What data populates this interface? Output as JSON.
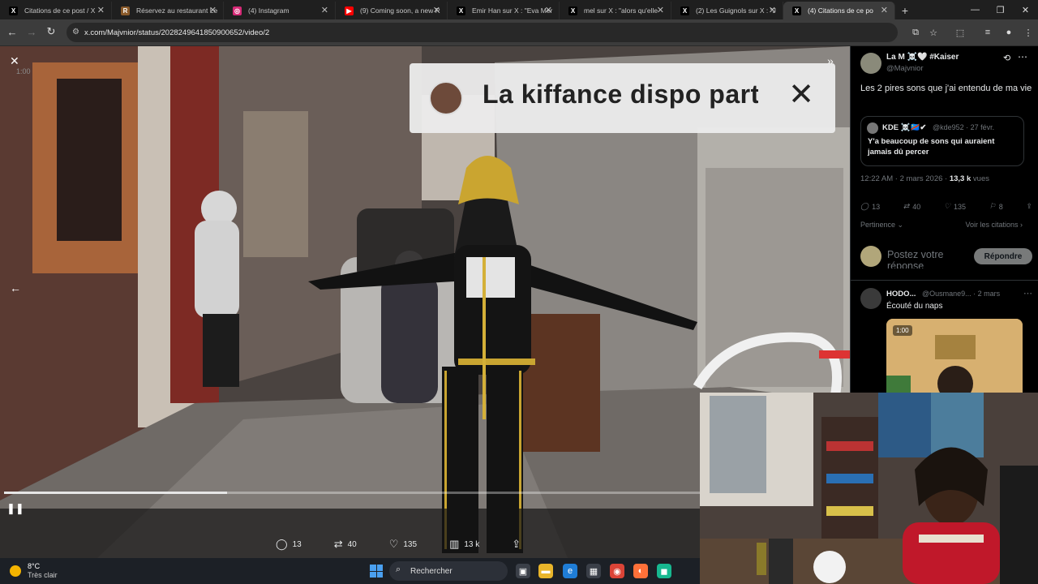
{
  "browser": {
    "tabs": [
      {
        "label": "Citations de ce post / X",
        "favicon": "x-icon",
        "color": "#000000",
        "glyph": "X"
      },
      {
        "label": "Réservez au restaurant Le",
        "favicon": "restaurant-icon",
        "color": "#8a5a2a",
        "glyph": "R"
      },
      {
        "label": "(4) Instagram",
        "favicon": "instagram-icon",
        "color": "#d62976",
        "glyph": "◎"
      },
      {
        "label": "(9) Coming soon, a new R",
        "favicon": "youtube-icon",
        "color": "#ff0000",
        "glyph": "▶"
      },
      {
        "label": "Emir Han sur X : \"Eva Mer",
        "favicon": "x-icon",
        "color": "#000000",
        "glyph": "X"
      },
      {
        "label": "mel sur X : \"alors qu'elle",
        "favicon": "x-icon",
        "color": "#000000",
        "glyph": "X"
      },
      {
        "label": "(2) Les Guignols sur X : \"J",
        "favicon": "x-icon",
        "color": "#000000",
        "glyph": "X"
      },
      {
        "label": "(4) Citations de ce po",
        "favicon": "x-icon",
        "color": "#000000",
        "glyph": "X",
        "active": true
      }
    ],
    "url": "x.com/Majvnior/status/2028249641850900652/video/2"
  },
  "video": {
    "timecode": "1:00",
    "banner_text": "La kiffance dispo part",
    "progress_fraction": 0.32,
    "actions": {
      "replies": "13",
      "reposts": "40",
      "likes": "135",
      "views": "13 k"
    }
  },
  "tweet": {
    "author_name": "La M ☠️🤍 #Kaiser",
    "author_handle": "@Majvnior",
    "text": "Les 2 pires sons que j'ai entendu de ma vie",
    "quote": {
      "name": "KDE ☠️🇨🇩✔",
      "meta": "@kde952 · 27 févr.",
      "text": "Y'a beaucoup de sons qui auraient jamais dû percer"
    },
    "timestamp": "12:22 AM · 2 mars 2026 ·",
    "views_count": "13,3 k",
    "views_label": "vues",
    "stats": {
      "replies": "13",
      "reposts": "40",
      "likes": "135",
      "bookmarks": "8"
    },
    "sort_label": "Pertinence",
    "quotes_link": "Voir les citations",
    "reply_placeholder": "Postez votre réponse",
    "reply_button": "Répondre"
  },
  "reply": {
    "name": "HODO...",
    "meta": "@Ousmane9... · 2 mars",
    "text": "Écouté du naps",
    "media_time": "1:00"
  },
  "taskbar": {
    "temperature": "8°C",
    "condition": "Très clair",
    "search_label": "Rechercher"
  }
}
